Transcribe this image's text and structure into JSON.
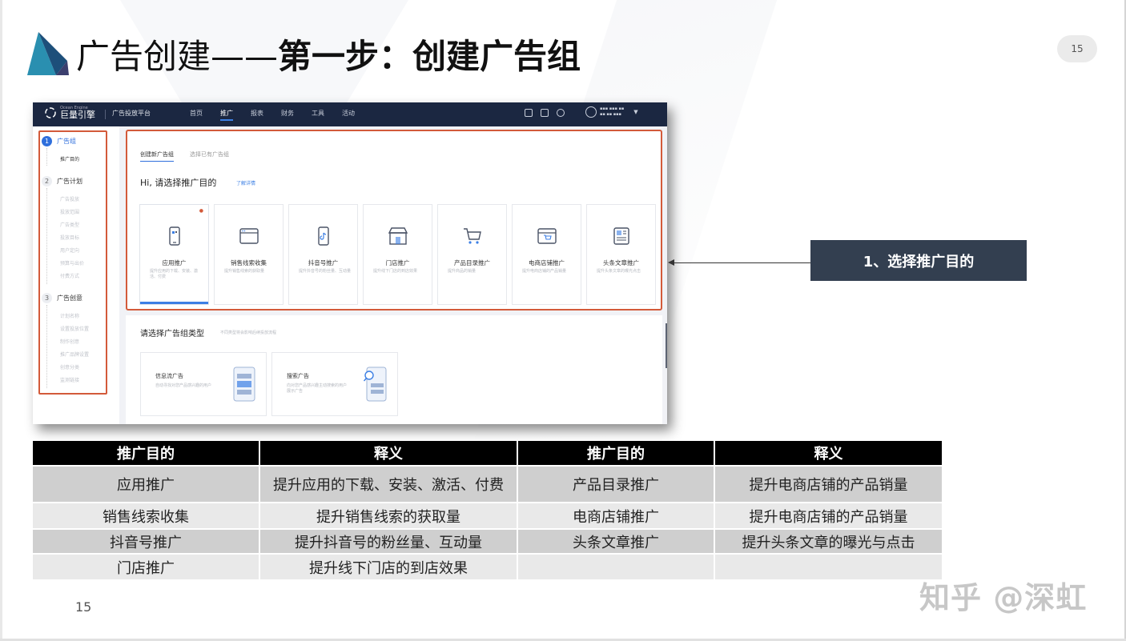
{
  "slide": {
    "title_part1": "广告创建——",
    "title_part2": "第一步：创建广告组",
    "page_badge": "15",
    "page_number": "15",
    "watermark": "知乎 @深虹"
  },
  "app": {
    "brand": "巨量引擎",
    "brand_sub": "Ocean Engine",
    "platform": "广告投放平台",
    "nav": [
      "首页",
      "推广",
      "报表",
      "财务",
      "工具",
      "活动"
    ],
    "nav_active": "推广",
    "sidebar": {
      "steps": [
        {
          "num": "1",
          "label": "广告组",
          "subs": [
            "推广目的"
          ]
        },
        {
          "num": "2",
          "label": "广告计划",
          "subs": [
            "广告投放",
            "投放范围",
            "广告类型",
            "投放目标",
            "用户定向",
            "预算与出价",
            "付费方式"
          ]
        },
        {
          "num": "3",
          "label": "广告创意",
          "subs": [
            "计划名称",
            "设置投放位置",
            "制作创意",
            "推广品牌设置",
            "创意分类",
            "监测链接"
          ]
        }
      ]
    },
    "tabs": [
      "创建新广告组",
      "选择已有广告组"
    ],
    "prompt": "Hi, 请选择推广目的",
    "learn_more": "了解详情",
    "purpose_cards": [
      {
        "icon": "app-phone-icon",
        "title": "应用推广",
        "desc": "提升应用的下载、安装、激活、付费"
      },
      {
        "icon": "browser-window-icon",
        "title": "销售线索收集",
        "desc": "提升销售线索的获取量"
      },
      {
        "icon": "douyin-phone-icon",
        "title": "抖音号推广",
        "desc": "提升抖音号的粉丝量、互动量"
      },
      {
        "icon": "storefront-icon",
        "title": "门店推广",
        "desc": "提升线下门店的到店效果"
      },
      {
        "icon": "shopping-cart-icon",
        "title": "产品目录推广",
        "desc": "提升商品的销量"
      },
      {
        "icon": "shop-window-icon",
        "title": "电商店铺推广",
        "desc": "提升电商店铺的产品销量"
      },
      {
        "icon": "article-icon",
        "title": "头条文章推广",
        "desc": "提升头条文章的曝光点击"
      }
    ],
    "type_section": {
      "title": "请选择广告组类型",
      "hint": "不同类型将会影响后续投放流程",
      "cards": [
        {
          "title": "信息流广告",
          "desc": "自动寻找对您产品感兴趣的用户"
        },
        {
          "title": "搜索广告",
          "desc": "向对您产品感兴趣主动搜索的用户展示广告"
        }
      ]
    }
  },
  "callout": "1、选择推广目的",
  "table": {
    "headers": [
      "推广目的",
      "释义",
      "推广目的",
      "释义"
    ],
    "rows": [
      [
        "应用推广",
        "提升应用的下载、安装、激活、付费",
        "产品目录推广",
        "提升电商店铺的产品销量"
      ],
      [
        "销售线索收集",
        "提升销售线索的获取量",
        "电商店铺推广",
        "提升电商店铺的产品销量"
      ],
      [
        "抖音号推广",
        "提升抖音号的粉丝量、互动量",
        "头条文章推广",
        "提升头条文章的曝光与点击"
      ],
      [
        "门店推广",
        "提升线下门店的到店效果",
        "",
        ""
      ]
    ]
  }
}
